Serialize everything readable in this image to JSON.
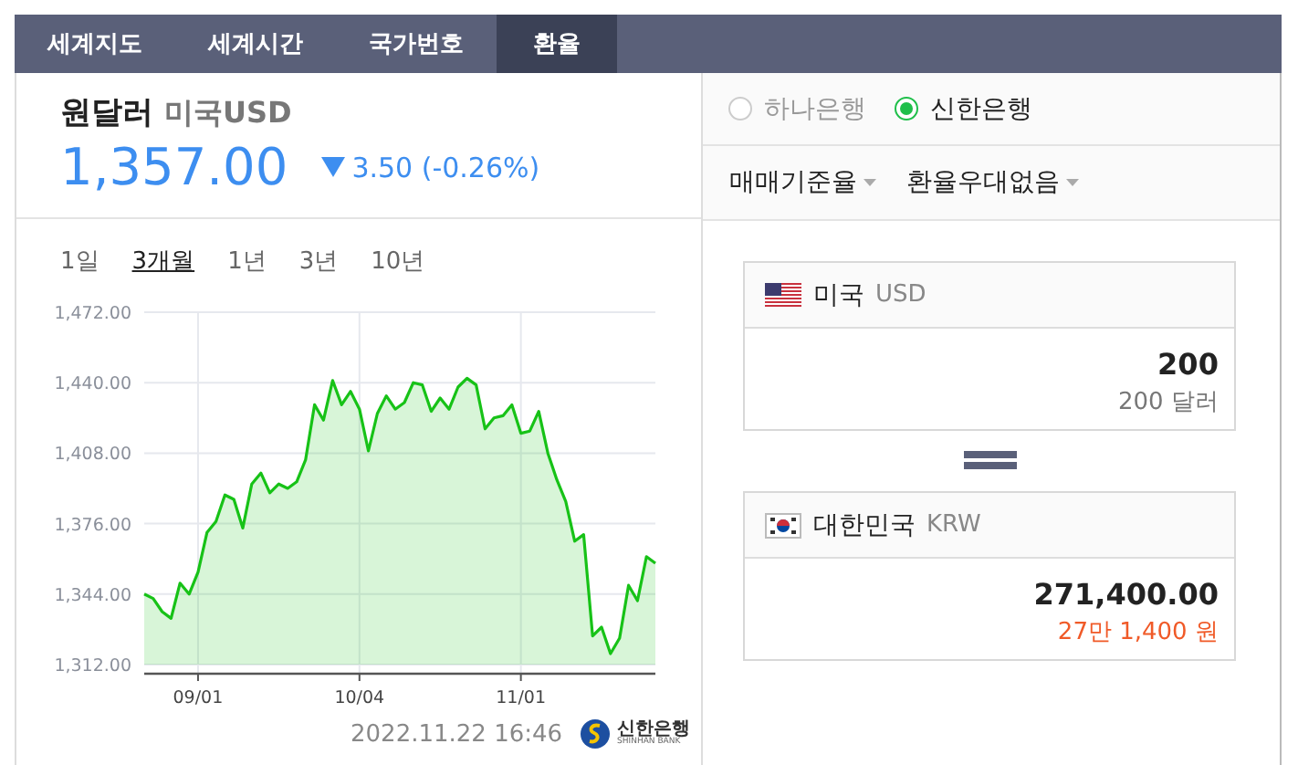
{
  "tabs": [
    {
      "label": "세계지도",
      "selected": false
    },
    {
      "label": "세계시간",
      "selected": false
    },
    {
      "label": "국가번호",
      "selected": false
    },
    {
      "label": "환율",
      "selected": true
    }
  ],
  "quote": {
    "title": "원달러",
    "subtitle": "미국USD",
    "price": "1,357.00",
    "kind": "down",
    "change": "3.50 (-0.26%)"
  },
  "periods": [
    {
      "label": "1일",
      "selected": false
    },
    {
      "label": "3개월",
      "selected": true
    },
    {
      "label": "1년",
      "selected": false
    },
    {
      "label": "3년",
      "selected": false
    },
    {
      "label": "10년",
      "selected": false
    }
  ],
  "chart_data": {
    "type": "area",
    "categories": [
      null,
      null,
      null,
      null,
      null,
      null,
      "09/01",
      null,
      null,
      null,
      null,
      null,
      null,
      null,
      null,
      null,
      null,
      null,
      null,
      null,
      null,
      null,
      null,
      null,
      "10/04",
      null,
      null,
      null,
      null,
      null,
      null,
      null,
      null,
      null,
      null,
      null,
      null,
      null,
      null,
      null,
      null,
      null,
      "11/01",
      null,
      null,
      null,
      null,
      null,
      null,
      null,
      null,
      null,
      null,
      null,
      null,
      null,
      null,
      null
    ],
    "series": [
      {
        "color": "#17c217",
        "values": [
          1344,
          1342,
          1336,
          1333,
          1349,
          1344,
          1354,
          1372,
          1377,
          1389,
          1387,
          1374,
          1394,
          1399,
          1390,
          1394,
          1392,
          1395,
          1405,
          1430,
          1423,
          1441,
          1430,
          1436,
          1428,
          1409,
          1426,
          1434,
          1428,
          1431,
          1440,
          1439,
          1427,
          1433,
          1428,
          1438,
          1442,
          1439,
          1419,
          1424,
          1425,
          1430,
          1417,
          1418,
          1427,
          1408,
          1396,
          1386,
          1368,
          1371,
          1325,
          1329,
          1317,
          1324,
          1348,
          1341,
          1361,
          1358
        ]
      }
    ],
    "ylim": [
      1312,
      1472
    ],
    "grid": true,
    "yticks": [
      {
        "value": 1472,
        "label": "1,472.00"
      },
      {
        "value": 1440,
        "label": "1,440.00"
      },
      {
        "value": 1408,
        "label": "1,408.00"
      },
      {
        "value": 1376,
        "label": "1,376.00"
      },
      {
        "value": 1344,
        "label": "1,344.00"
      },
      {
        "value": 1312,
        "label": "1,312.00"
      }
    ]
  },
  "timestamp": "2022.11.22 16:46",
  "bank_logo": {
    "name": "신한은행",
    "subtitle": "SHINHAN BANK"
  },
  "banks": [
    {
      "label": "하나은행",
      "selected": false
    },
    {
      "label": "신한은행",
      "selected": true
    }
  ],
  "dropdowns": [
    "매매기준율",
    "환율우대없음"
  ],
  "converter": [
    {
      "kind": "from",
      "flag": {
        "kind": "us"
      },
      "country": "미국",
      "code": "USD",
      "amount": "200",
      "amount_words": "200 달러"
    },
    {
      "kind": "to",
      "flag": {
        "kind": "kr"
      },
      "country": "대한민국",
      "code": "KRW",
      "amount": "271,400.00",
      "amount_words": "27만 1,400 원"
    }
  ]
}
